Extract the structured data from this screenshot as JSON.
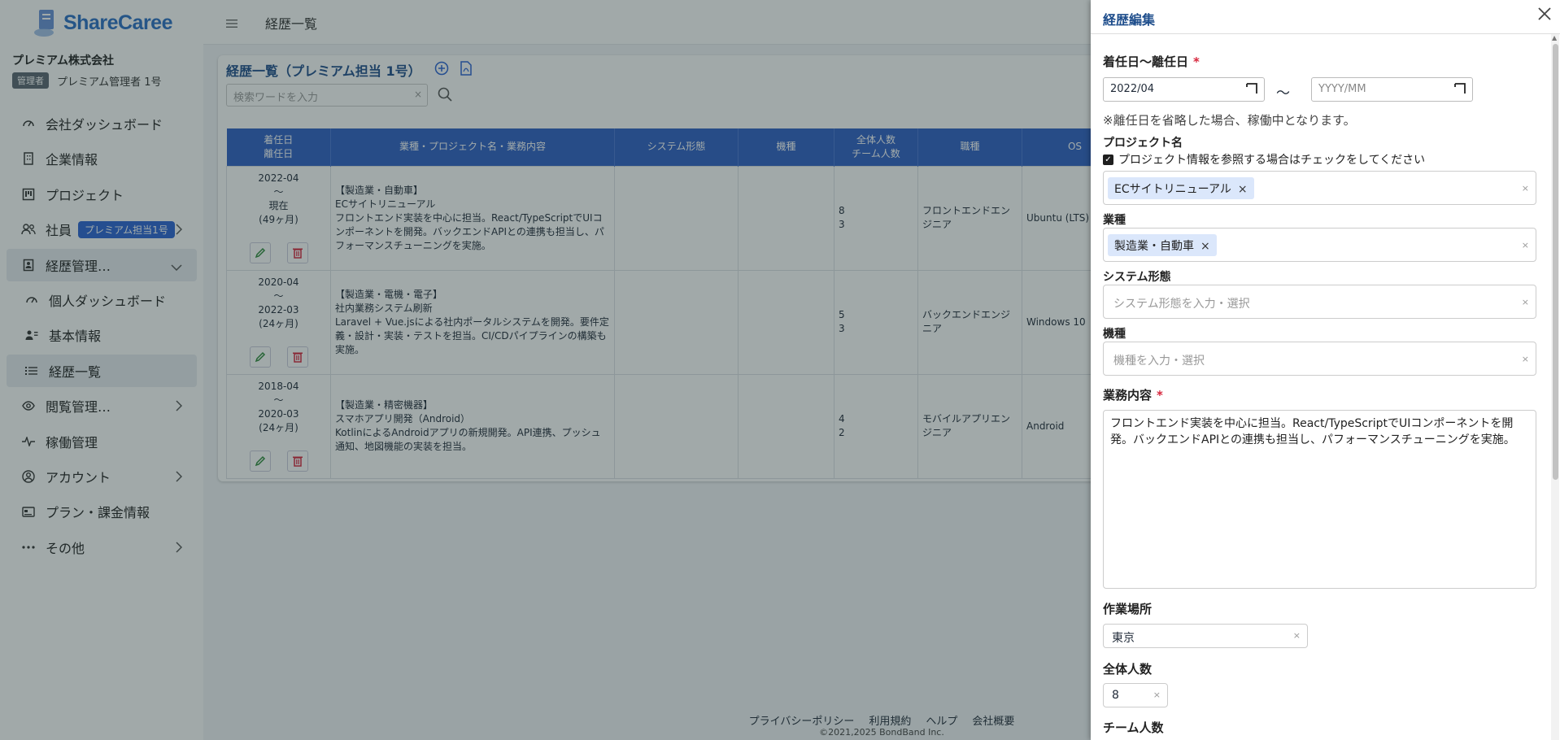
{
  "brand": {
    "share": "Share",
    "caree": "Caree"
  },
  "company_name": "プレミアム株式会社",
  "role_badge": "管理者",
  "user_name": "プレミアム管理者 1号",
  "nav": {
    "dashboard": "会社ダッシュボード",
    "company_info": "企業情報",
    "project": "プロジェクト",
    "employee": "社員",
    "employee_pill": "プレミアム担当1号",
    "career_mgmt": "経歴管理…",
    "personal_dashboard": "個人ダッシュボード",
    "basic_info": "基本情報",
    "career_list": "経歴一覧",
    "view_mgmt": "閲覧管理…",
    "work_mgmt": "稼働管理",
    "account": "アカウント",
    "plan": "プラン・課金情報",
    "other": "その他"
  },
  "topbar": {
    "title": "経歴一覧"
  },
  "card": {
    "title": "経歴一覧（プレミアム担当 1号）",
    "search_placeholder": "検索ワードを入力"
  },
  "table": {
    "headers": {
      "date1": "着任日",
      "date2": "離任日",
      "project": "業種・プロジェクト名・業務内容",
      "system": "システム形態",
      "model": "機種",
      "num1": "全体人数",
      "num2": "チーム人数",
      "job": "職種",
      "os": "OS"
    },
    "rows": [
      {
        "start": "2022-04",
        "sep": "〜",
        "end": "現在",
        "dur": "(49ヶ月)",
        "industry": "【製造業・自動車】",
        "name": "ECサイトリニューアル",
        "desc": "フロントエンド実装を中心に担当。React/TypeScriptでUIコンポーネントを開発。バックエンドAPIとの連携も担当し、パフォーマンスチューニングを実施。",
        "total": "8",
        "team": "3",
        "job": "フロントエンドエンジニア",
        "os": "Ubuntu (LTS)"
      },
      {
        "start": "2020-04",
        "sep": "〜",
        "end": "2022-03",
        "dur": "(24ヶ月)",
        "industry": "【製造業・電機・電子】",
        "name": "社内業務システム刷新",
        "desc": "Laravel + Vue.jsによる社内ポータルシステムを開発。要件定義・設計・実装・テストを担当。CI/CDパイプラインの構築も実施。",
        "total": "5",
        "team": "3",
        "job": "バックエンドエンジニア",
        "os": "Windows 10"
      },
      {
        "start": "2018-04",
        "sep": "〜",
        "end": "2020-03",
        "dur": "(24ヶ月)",
        "industry": "【製造業・精密機器】",
        "name": "スマホアプリ開発（Android）",
        "desc": "KotlinによるAndroidアプリの新規開発。API連携、プッシュ通知、地図機能の実装を担当。",
        "total": "4",
        "team": "2",
        "job": "モバイルアプリエンジニア",
        "os": "Android"
      }
    ]
  },
  "footer": {
    "privacy": "プライバシーポリシー",
    "terms": "利用規約",
    "help": "ヘルプ",
    "company": "会社概要",
    "copyright": "©2021,2025 BondBand Inc."
  },
  "drawer": {
    "title": "経歴編集",
    "period_label": "着任日〜離任日",
    "required_mark": "*",
    "start_value": "2022/04",
    "end_placeholder": "YYYY/MM",
    "tilde": "〜",
    "end_note": "※離任日を省略した場合、稼働中となります。",
    "project_label": "プロジェクト名",
    "project_check": "プロジェクト情報を参照する場合はチェックをしてください",
    "project_tag": "ECサイトリニューアル",
    "industry_label": "業種",
    "industry_tag": "製造業・自動車",
    "system_label": "システム形態",
    "system_placeholder": "システム形態を入力・選択",
    "model_label": "機種",
    "model_placeholder": "機種を入力・選択",
    "work_label": "業務内容",
    "work_value": "フロントエンド実装を中心に担当。React/TypeScriptでUIコンポーネントを開発。バックエンドAPIとの連携も担当し、パフォーマンスチューニングを実施。",
    "place_label": "作業場所",
    "place_value": "東京",
    "total_label": "全体人数",
    "total_value": "8",
    "team_label": "チーム人数"
  },
  "colors": {
    "accent": "#2d5fc5",
    "brand": "#2a6fc4",
    "danger": "#d7263d"
  }
}
